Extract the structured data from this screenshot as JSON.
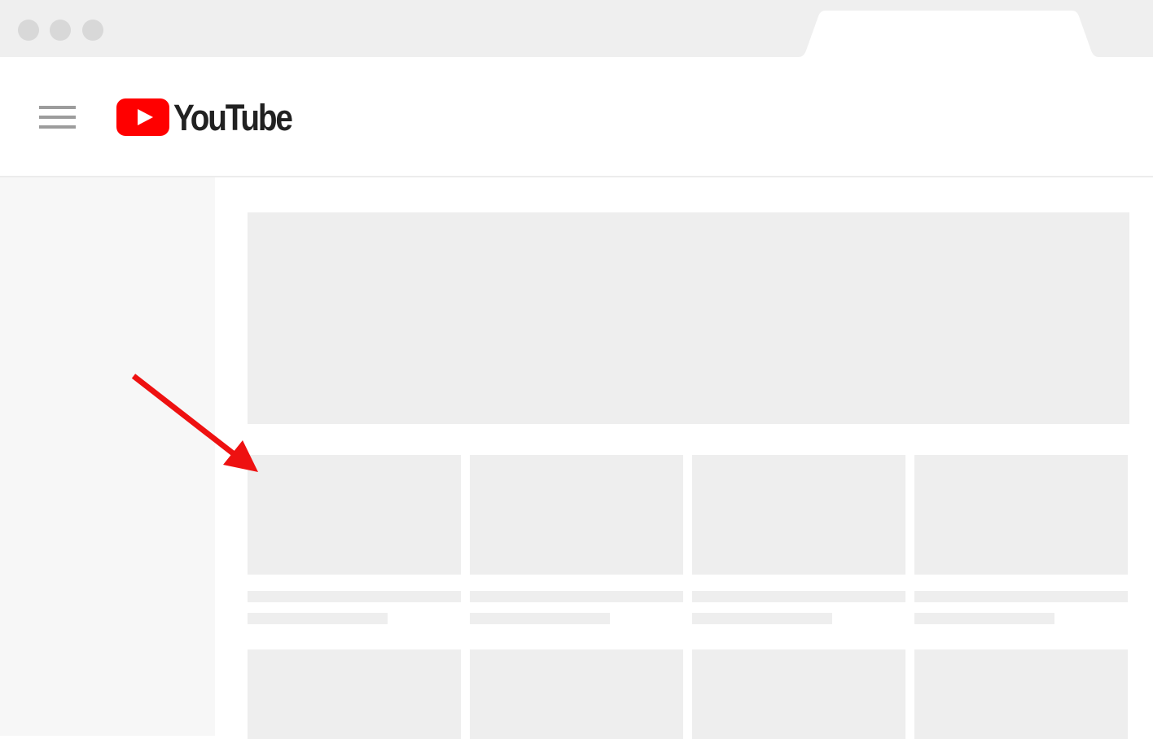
{
  "browser": {
    "window_controls": [
      "close",
      "minimize",
      "maximize"
    ],
    "active_tab": ""
  },
  "header": {
    "menu_icon": "hamburger-menu-icon",
    "logo": {
      "text": "YouTube",
      "brand_color": "#ff0000",
      "text_color": "#212121"
    }
  },
  "annotation": {
    "icon": "arrow-icon",
    "color": "#ee1111"
  },
  "content": {
    "placeholder_color": "#eeeeee",
    "sidebar_color": "#f7f7f7"
  }
}
